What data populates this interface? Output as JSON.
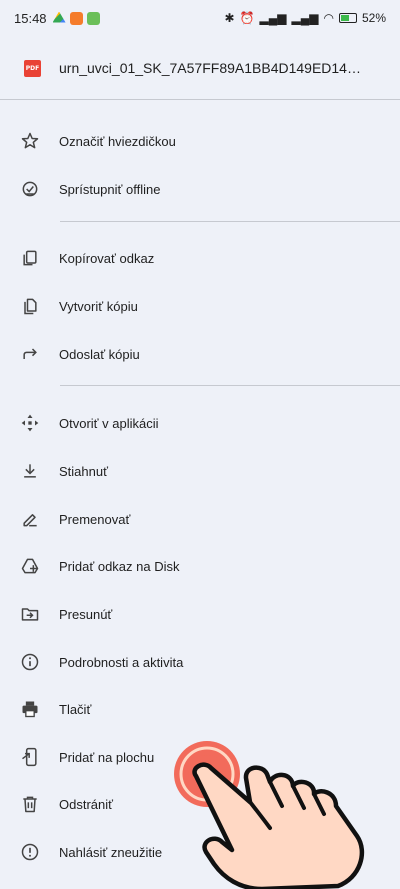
{
  "status_bar": {
    "time": "15:48",
    "battery_percent": "52%",
    "battery_level": 0.52
  },
  "file": {
    "icon_label": "PDF",
    "name": "urn_uvci_01_SK_7A57FF89A1BB4D149ED14BE3DF..."
  },
  "menu": {
    "star": "Označiť hviezdičkou",
    "offline": "Sprístupniť offline",
    "copy_link": "Kopírovať odkaz",
    "make_copy": "Vytvoriť kópiu",
    "send_copy": "Odoslať kópiu",
    "open_in_app": "Otvoriť v aplikácii",
    "download": "Stiahnuť",
    "rename": "Premenovať",
    "add_shortcut": "Pridať odkaz na Disk",
    "move": "Presunúť",
    "details": "Podrobnosti a aktivita",
    "print": "Tlačiť",
    "add_to_home": "Pridať na plochu",
    "remove": "Odstrániť",
    "report": "Nahlásiť zneužitie"
  },
  "colors": {
    "background": "#eef1f8",
    "pdf_red": "#e94235",
    "tap_indicator": "#f26b5b",
    "hand_fill": "#ffd8c4"
  }
}
